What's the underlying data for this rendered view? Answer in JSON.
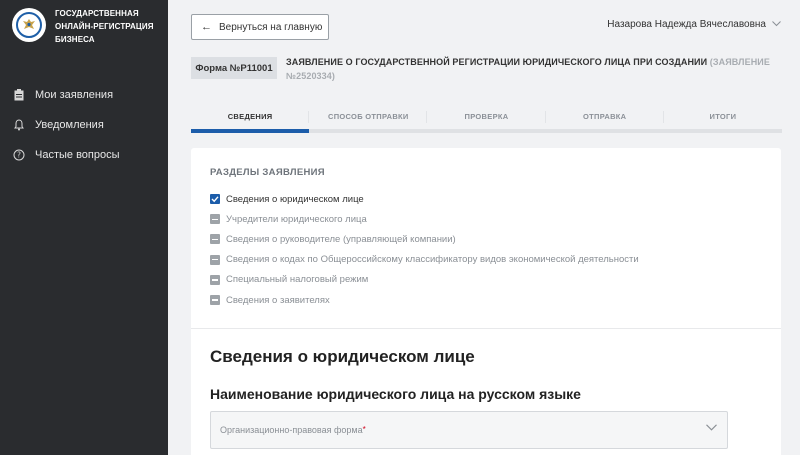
{
  "sidebar": {
    "brand": [
      "ГОСУДАРСТВЕННАЯ",
      "ОНЛАЙН-РЕГИСТРАЦИЯ",
      "БИЗНЕСА"
    ],
    "items": [
      {
        "label": "Мои заявления",
        "icon": "clipboard-icon"
      },
      {
        "label": "Уведомления",
        "icon": "bell-icon"
      },
      {
        "label": "Частые вопросы",
        "icon": "question-circle-icon"
      }
    ]
  },
  "header": {
    "back_label": "Вернуться на главную",
    "user_name": "Назарова Надежда Вячеславовна"
  },
  "form": {
    "badge": "Форма №Р11001",
    "title": "ЗАЯВЛЕНИЕ О ГОСУДАРСТВЕННОЙ РЕГИСТРАЦИИ ЮРИДИЧЕСКОГО ЛИЦА ПРИ СОЗДАНИИ",
    "application_no": "(ЗАЯВЛЕНИЕ №2520334)"
  },
  "tabs": [
    "СВЕДЕНИЯ",
    "СПОСОБ ОТПРАВКИ",
    "ПРОВЕРКА",
    "ОТПРАВКА",
    "ИТОГИ"
  ],
  "active_tab": 0,
  "sections": {
    "heading": "РАЗДЕЛЫ ЗАЯВЛЕНИЯ",
    "items": [
      {
        "label": "Сведения о юридическом лице",
        "checked": true
      },
      {
        "label": "Учредители юридического лица",
        "checked": false
      },
      {
        "label": "Сведения о руководителе (управляющей компании)",
        "checked": false
      },
      {
        "label": "Сведения о кодах по Общероссийскому классификатору видов экономической деятельности",
        "checked": false
      },
      {
        "label": "Специальный налоговый режим",
        "checked": false
      },
      {
        "label": "Сведения о заявителях",
        "checked": false
      }
    ]
  },
  "content": {
    "h1": "Сведения о юридическом лице",
    "h2": "Наименование юридического лица на русском языке",
    "select_placeholder": "Организационно-правовая форма",
    "required_mark": "*"
  },
  "colors": {
    "sidebar_bg": "#2a2c2f",
    "accent": "#1c5daa",
    "required": "#d0021b"
  }
}
